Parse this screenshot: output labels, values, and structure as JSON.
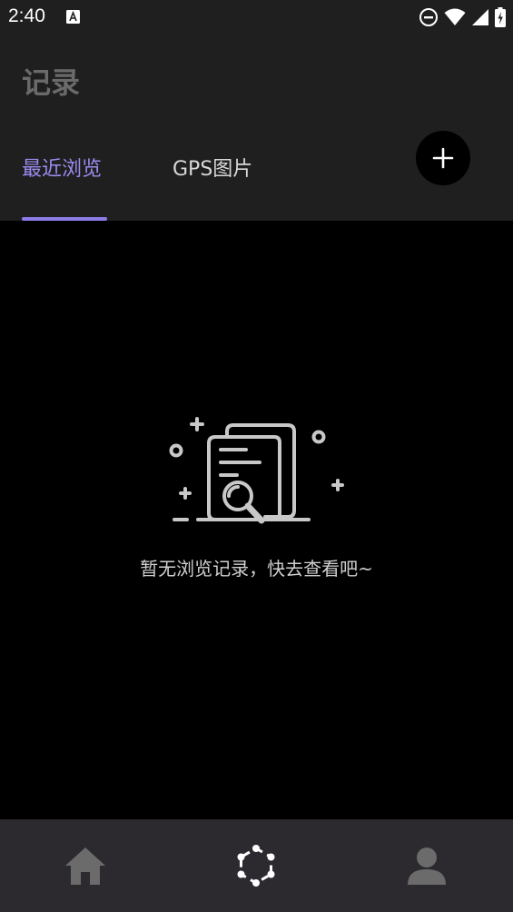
{
  "status_bar": {
    "time": "2:40",
    "icons": [
      "notification-a-icon",
      "do-not-disturb-icon",
      "wifi-icon",
      "signal-icon",
      "battery-icon"
    ]
  },
  "header": {
    "title": "记录",
    "tabs": [
      {
        "label": "最近浏览",
        "active": true
      },
      {
        "label": "GPS图片",
        "active": false
      }
    ],
    "add_button_icon": "plus-icon"
  },
  "empty_state": {
    "icon": "documents-search-icon",
    "message": "暂无浏览记录，快去查看吧~"
  },
  "bottom_nav": {
    "items": [
      {
        "icon": "home-icon",
        "active": false
      },
      {
        "icon": "hexagon-nodes-icon",
        "active": true
      },
      {
        "icon": "profile-icon",
        "active": false
      }
    ]
  },
  "colors": {
    "accent": "#8b7ce8",
    "header_bg": "#1f1f1f",
    "content_bg": "#000000",
    "nav_bg": "#2c2a2f"
  }
}
